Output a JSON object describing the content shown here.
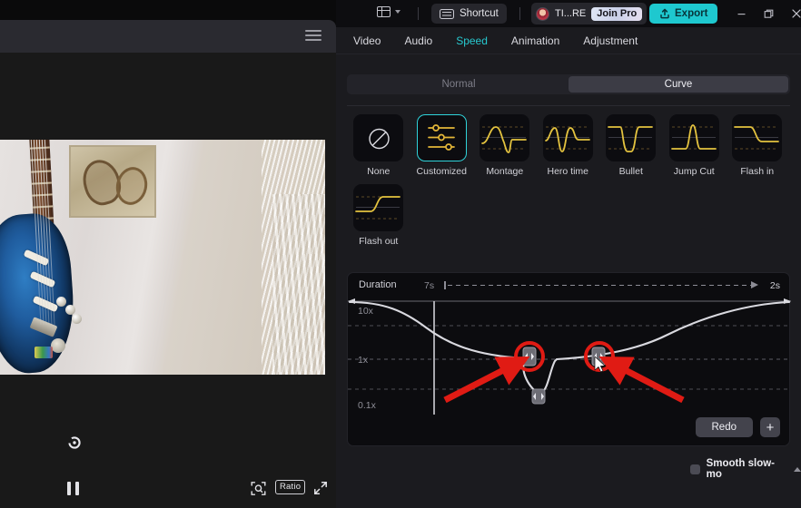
{
  "titlebar": {
    "layout_icon": "layout-panel-icon",
    "layout_caret": "chevron-down-icon",
    "shortcut_icon": "keyboard-icon",
    "shortcut_label": "Shortcut",
    "avatar_icon": "user-avatar",
    "account_name": "TI...RE",
    "join_pro_label": "Join Pro",
    "export_icon": "upload-icon",
    "export_label": "Export",
    "minimize_icon": "minimize-icon",
    "maximize_icon": "maximize-icon",
    "close_icon": "close-icon",
    "accent_color": "#1ec8cf"
  },
  "tabs": [
    {
      "label": "Video",
      "active": false
    },
    {
      "label": "Audio",
      "active": false
    },
    {
      "label": "Speed",
      "active": true
    },
    {
      "label": "Animation",
      "active": false
    },
    {
      "label": "Adjustment",
      "active": false
    }
  ],
  "mode_switch": {
    "options": [
      {
        "label": "Normal",
        "active": false
      },
      {
        "label": "Curve",
        "active": true
      }
    ]
  },
  "presets": [
    {
      "label": "None",
      "icon": "no-speed-icon",
      "selected": false
    },
    {
      "label": "Customized",
      "icon": "sliders-icon",
      "selected": true
    },
    {
      "label": "Montage",
      "icon": "montage-curve-icon",
      "selected": false
    },
    {
      "label": "Hero time",
      "icon": "hero-time-curve-icon",
      "selected": false
    },
    {
      "label": "Bullet",
      "icon": "bullet-curve-icon",
      "selected": false
    },
    {
      "label": "Jump Cut",
      "icon": "jump-cut-curve-icon",
      "selected": false
    },
    {
      "label": "Flash in",
      "icon": "flash-in-curve-icon",
      "selected": false
    },
    {
      "label": "Flash out",
      "icon": "flash-out-curve-icon",
      "selected": false
    }
  ],
  "curve_editor": {
    "duration_label": "Duration",
    "original_duration": "7s",
    "result_duration": "2s",
    "y_labels": [
      "10x",
      "1x",
      "0.1x"
    ],
    "redo_label": "Redo",
    "add_keyframe_label": "+",
    "selected_keyframes": 2,
    "keyframe_count": 3
  },
  "smooth_slow_mo": {
    "label": "Smooth slow-mo",
    "checked": false,
    "caret_icon": "chevron-up-icon"
  },
  "preview": {
    "hamburger_icon": "hamburger-menu-icon",
    "replay_icon": "replay-icon",
    "pause_icon": "pause-icon",
    "zoom_fit_icon": "zoom-fit-icon",
    "ratio_label": "Ratio",
    "fullscreen_icon": "fullscreen-icon"
  },
  "annotations": {
    "arrows": 2,
    "highlight_circles": 2,
    "color": "#e01b14"
  }
}
